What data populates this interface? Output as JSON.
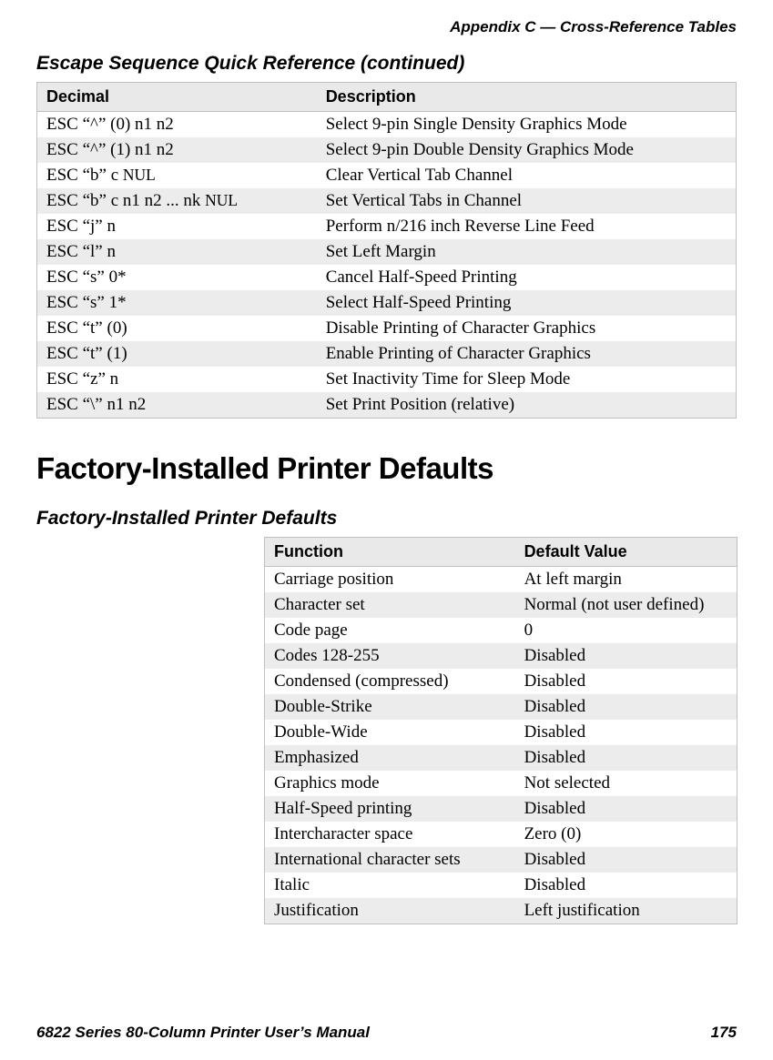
{
  "header": {
    "running": "Appendix C — Cross-Reference Tables"
  },
  "section1": {
    "title": "Escape Sequence Quick Reference (continued)",
    "columns": {
      "c1": "Decimal",
      "c2": "Description"
    },
    "rows": [
      {
        "dec": "ESC “^” (0) n1 n2",
        "desc": "Select 9-pin Single Density Graphics Mode"
      },
      {
        "dec": "ESC “^” (1) n1 n2",
        "desc": "Select 9-pin Double Density Graphics Mode"
      },
      {
        "dec_prefix": "ESC “b” c ",
        "dec_sc": "NUL",
        "desc": "Clear Vertical Tab Channel"
      },
      {
        "dec_prefix": "ESC “b” c n1 n2 ... nk ",
        "dec_sc": "NUL",
        "desc": "Set Vertical Tabs in Channel"
      },
      {
        "dec": "ESC “j” n",
        "desc": "Perform n/216 inch Reverse Line Feed"
      },
      {
        "dec": "ESC “l” n",
        "desc": "Set Left Margin"
      },
      {
        "dec": "ESC “s” 0*",
        "desc": "Cancel Half-Speed Printing"
      },
      {
        "dec": "ESC “s” 1*",
        "desc": "Select Half-Speed Printing"
      },
      {
        "dec": "ESC “t” (0)",
        "desc": "Disable Printing of Character Graphics"
      },
      {
        "dec": "ESC “t” (1)",
        "desc": "Enable Printing of Character Graphics"
      },
      {
        "dec": "ESC “z” n",
        "desc": "Set Inactivity Time for Sleep Mode"
      },
      {
        "dec": "ESC “\\” n1 n2",
        "desc": "Set Print Position (relative)"
      }
    ]
  },
  "heading2": "Factory-Installed Printer Defaults",
  "section2": {
    "title": "Factory-Installed Printer Defaults",
    "columns": {
      "c1": "Function",
      "c2": "Default Value"
    },
    "rows": [
      {
        "fn": "Carriage position",
        "val": "At left margin"
      },
      {
        "fn": "Character set",
        "val": "Normal (not user defined)"
      },
      {
        "fn": "Code page",
        "val": "0"
      },
      {
        "fn": "Codes 128-255",
        "val": "Disabled"
      },
      {
        "fn": "Condensed (compressed)",
        "val": "Disabled"
      },
      {
        "fn": "Double-Strike",
        "val": "Disabled"
      },
      {
        "fn": "Double-Wide",
        "val": "Disabled"
      },
      {
        "fn": "Emphasized",
        "val": "Disabled"
      },
      {
        "fn": "Graphics mode",
        "val": "Not selected"
      },
      {
        "fn": "Half-Speed printing",
        "val": "Disabled"
      },
      {
        "fn": "Intercharacter space",
        "val": "Zero (0)"
      },
      {
        "fn": "International character sets",
        "val": "Disabled"
      },
      {
        "fn": "Italic",
        "val": "Disabled"
      },
      {
        "fn": "Justification",
        "val": "Left justification"
      }
    ]
  },
  "footer": {
    "left": "6822 Series 80-Column Printer User’s Manual",
    "right": "175"
  }
}
